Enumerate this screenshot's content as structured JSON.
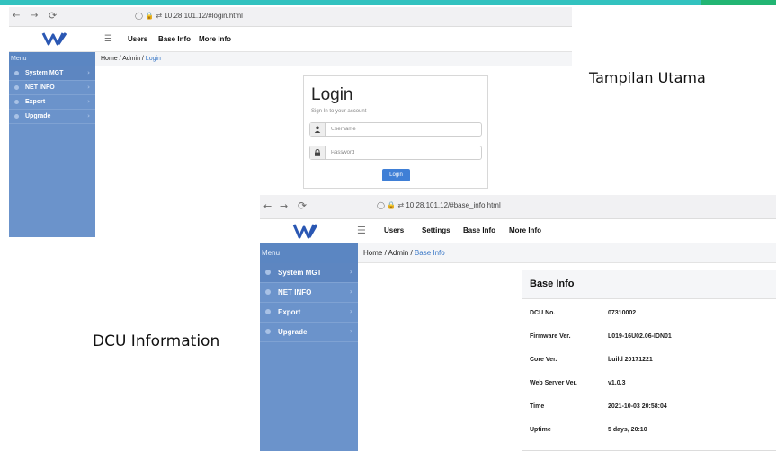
{
  "colors": {
    "accent_teal": "#32c2bf",
    "accent_green": "#22b573",
    "sidebar_bg": "#6b93cb",
    "login_button": "#3f7fd6",
    "logo_blue": "#2a57b3"
  },
  "captions": {
    "main_view": "Tampilan Utama",
    "dcu_information": "DCU Information"
  },
  "login_screen": {
    "browser": {
      "back_icon": "arrow-left-icon",
      "forward_icon": "arrow-right-icon",
      "reload_icon": "reload-icon",
      "url": "10.28.101.12/#login.html"
    },
    "nav": {
      "links": [
        "Users",
        "Base Info",
        "More Info"
      ]
    },
    "sidebar": {
      "header": "Menu",
      "items": [
        "System MGT",
        "NET INFO",
        "Export",
        "Upgrade"
      ]
    },
    "breadcrumb": {
      "path": "Home / Admin / ",
      "current": "Login"
    },
    "form": {
      "title": "Login",
      "subtitle": "Sign In to your account",
      "username_placeholder": "Username",
      "password_placeholder": "Password",
      "button": "Login"
    }
  },
  "info_screen": {
    "browser": {
      "url": "10.28.101.12/#base_info.html"
    },
    "nav": {
      "links": [
        "Users",
        "Settings",
        "Base Info",
        "More Info"
      ]
    },
    "sidebar": {
      "header": "Menu",
      "items": [
        "System MGT",
        "NET INFO",
        "Export",
        "Upgrade"
      ]
    },
    "breadcrumb": {
      "path": "Home / Admin / ",
      "current": "Base Info"
    },
    "panel": {
      "title": "Base Info",
      "rows": [
        {
          "label": "DCU No.",
          "value": "07310002"
        },
        {
          "label": "Firmware Ver.",
          "value": "L019-16U02.06-IDN01"
        },
        {
          "label": "Core Ver.",
          "value": "build 20171221"
        },
        {
          "label": "Web Server Ver.",
          "value": "v1.0.3"
        },
        {
          "label": "Time",
          "value": "2021-10-03 20:58:04"
        },
        {
          "label": "Uptime",
          "value": "5 days, 20:10"
        }
      ]
    }
  }
}
